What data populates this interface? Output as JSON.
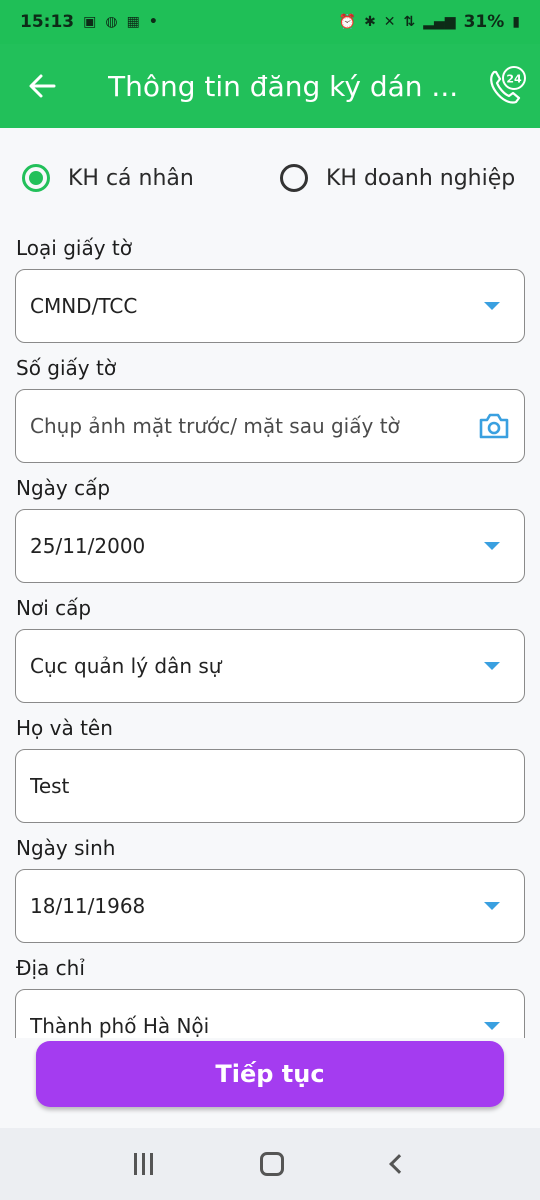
{
  "status_bar": {
    "time": "15:13",
    "left_icons": [
      "notification-icon",
      "bag-icon",
      "chat-icon",
      "momo-icon",
      "dot-icon"
    ],
    "right_icons": [
      "alarm-icon",
      "bluetooth-icon",
      "mute-icon",
      "4g-icon",
      "signal-icon",
      "battery-icon"
    ],
    "battery": "31%"
  },
  "app_bar": {
    "title": "Thông tin đăng ký dán ...",
    "support_badge": "24"
  },
  "customer_type": {
    "options": [
      {
        "label": "KH cá nhân",
        "selected": true
      },
      {
        "label": "KH doanh nghiệp",
        "selected": false
      }
    ]
  },
  "fields": [
    {
      "label": "Loại giấy tờ",
      "value": "CMND/TCC",
      "kind": "dropdown"
    },
    {
      "label": "Số giấy tờ",
      "placeholder": "Chụp ảnh mặt trước/ mặt sau giấy tờ",
      "kind": "camera"
    },
    {
      "label": "Ngày cấp",
      "value": "25/11/2000",
      "kind": "dropdown"
    },
    {
      "label": "Nơi cấp",
      "value": "Cục quản lý dân sự",
      "kind": "dropdown"
    },
    {
      "label": "Họ và tên",
      "value": "Test",
      "kind": "text"
    },
    {
      "label": "Ngày sinh",
      "value": "18/11/1968",
      "kind": "dropdown"
    },
    {
      "label": "Địa chỉ",
      "value": "Thành phố Hà Nội",
      "kind": "dropdown"
    }
  ],
  "continue_button": "Tiếp tục",
  "colors": {
    "primary_green": "#22c05a",
    "button_purple": "#a43cf0",
    "caret_blue": "#3aa0e0"
  }
}
